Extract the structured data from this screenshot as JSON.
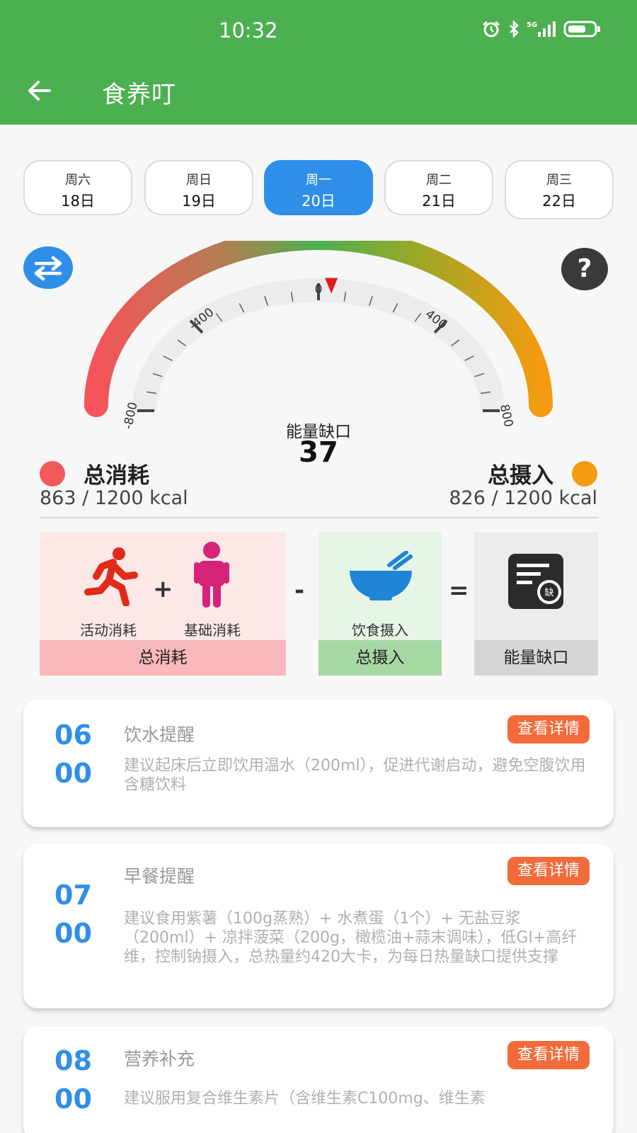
{
  "status_bar": {
    "time": "10:32"
  },
  "header": {
    "title": "食养叮"
  },
  "dates": [
    {
      "week": "周六",
      "day": "18日",
      "selected": false
    },
    {
      "week": "周日",
      "day": "19日",
      "selected": false
    },
    {
      "week": "周一",
      "day": "20日",
      "selected": true
    },
    {
      "week": "周二",
      "day": "21日",
      "selected": false
    },
    {
      "week": "周三",
      "day": "22日",
      "selected": false
    }
  ],
  "gauge": {
    "ticks": [
      "-800",
      "-400",
      "0",
      "400",
      "800"
    ],
    "label": "能量缺口",
    "value": "37",
    "range": [
      -800,
      800
    ]
  },
  "summary": {
    "burn_title": "总消耗",
    "burn_value": "863 / 1200 kcal",
    "intake_title": "总摄入",
    "intake_value": "826 / 1200 kcal",
    "burn_color": "#f25a5a",
    "intake_color": "#f59b10"
  },
  "formula": {
    "activity_label": "活动消耗",
    "basal_label": "基础消耗",
    "diet_label": "饮食摄入",
    "burn_footer": "总消耗",
    "intake_footer": "总摄入",
    "gap_footer": "能量缺口",
    "plus": "+",
    "minus": "-",
    "equals": "=",
    "gap_icon_char": "缺"
  },
  "cards": [
    {
      "hour": "06",
      "minute": "00",
      "title": "饮水提醒",
      "button": "查看详情",
      "desc": "建议起床后立即饮用温水（200ml），促进代谢启动，避免空腹饮用含糖饮料"
    },
    {
      "hour": "07",
      "minute": "00",
      "title": "早餐提醒",
      "button": "查看详情",
      "desc": "建议食用紫薯（100g蒸熟）+ 水煮蛋（1个）+ 无盐豆浆（200ml）+ 凉拌菠菜（200g，橄榄油+蒜末调味），低GI+高纤维，控制钠摄入，总热量约420大卡，为每日热量缺口提供支撑"
    },
    {
      "hour": "08",
      "minute": "00",
      "title": "营养补充",
      "button": "查看详情",
      "desc": "建议服用复合维生素片（含维生素C100mg、维生素"
    }
  ],
  "colors": {
    "primary": "#4caf50",
    "accent": "#2f8fe8",
    "button": "#f26b3a"
  }
}
